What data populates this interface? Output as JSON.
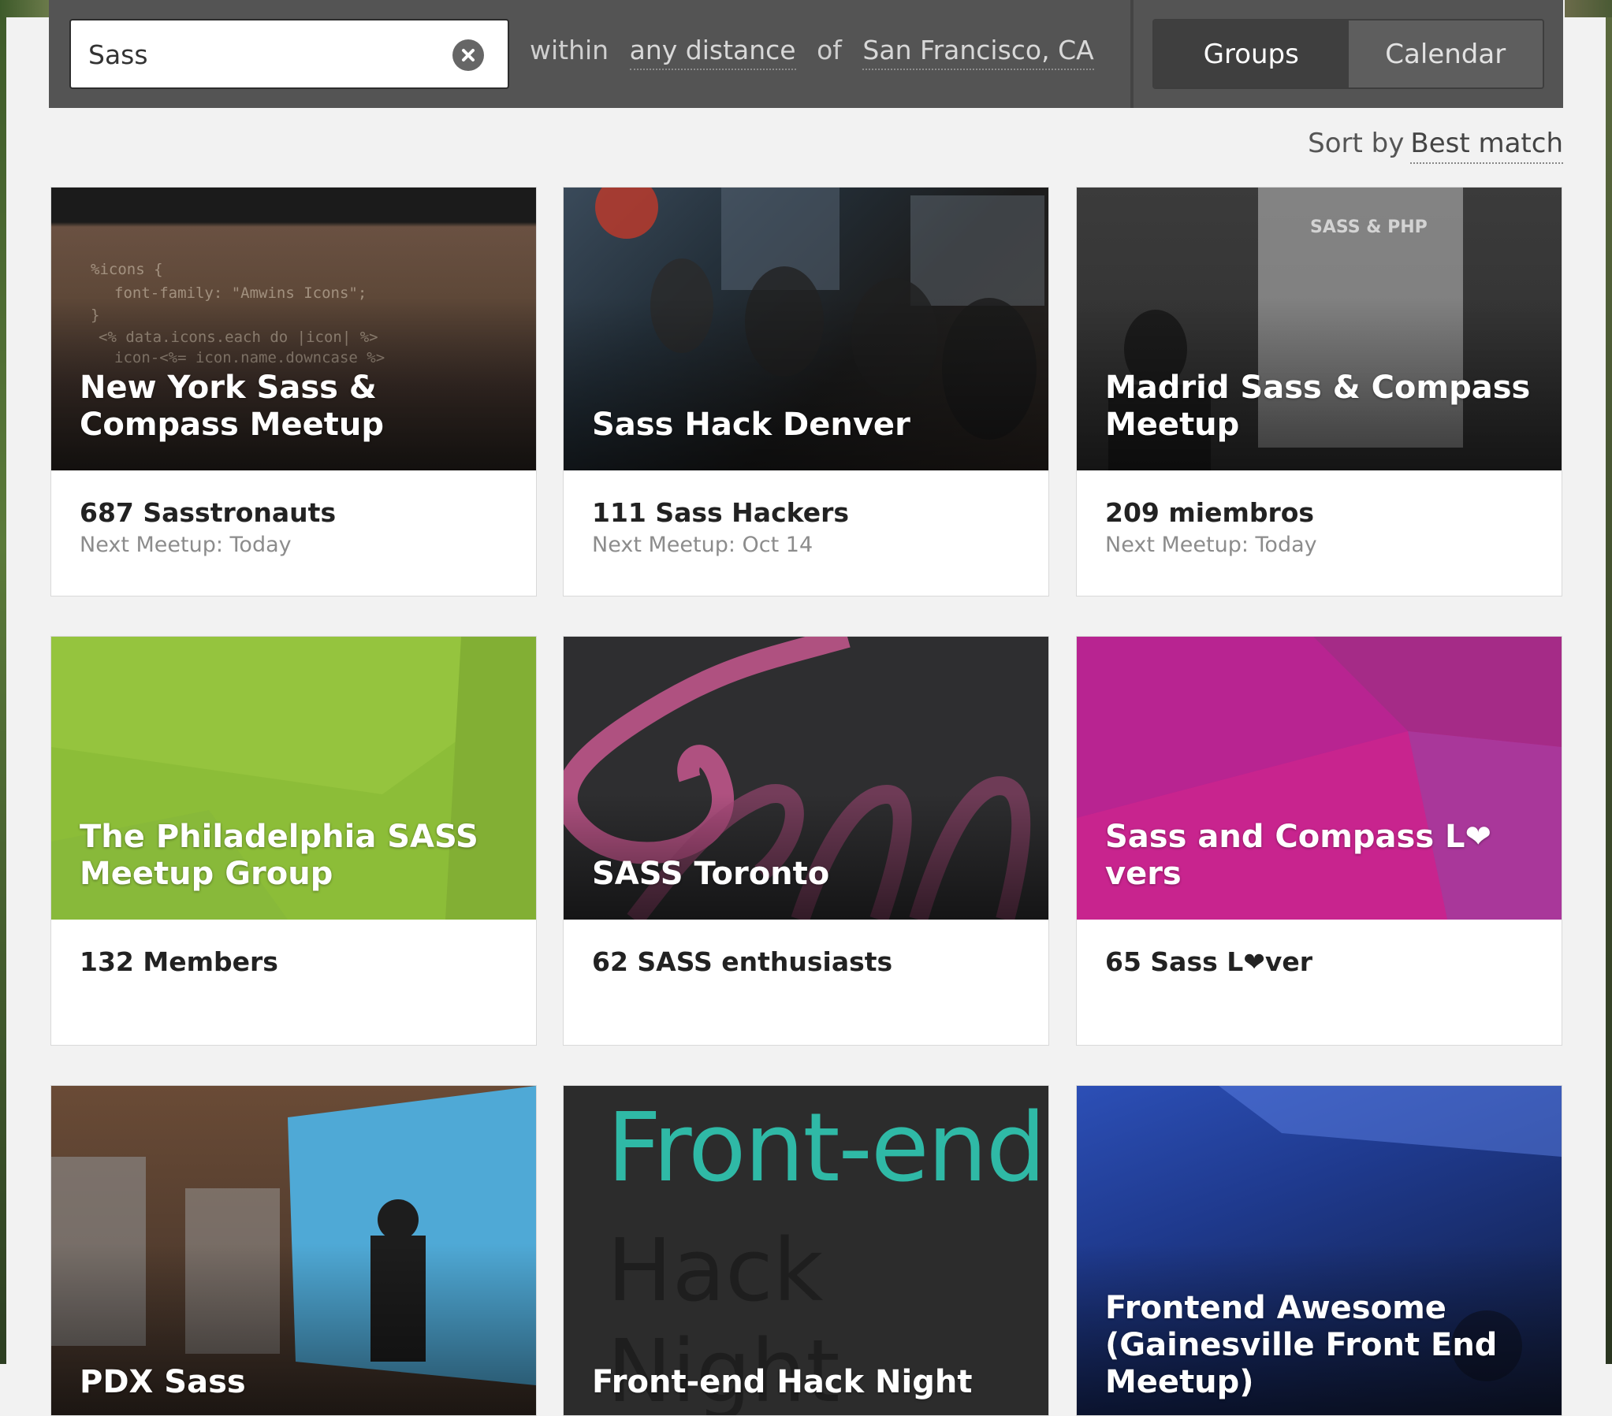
{
  "search": {
    "query": "Sass",
    "within_label": "within",
    "distance": "any distance",
    "of_label": "of",
    "location": "San Francisco, CA"
  },
  "view_toggle": {
    "groups": "Groups",
    "calendar": "Calendar",
    "active": "Groups"
  },
  "sort": {
    "label": "Sort by",
    "value": "Best match"
  },
  "groups": [
    {
      "title": "New York Sass & Compass Meetup",
      "count": "687 Sasstronauts",
      "next": "Next Meetup: Today"
    },
    {
      "title": "Sass Hack Denver",
      "count": "111 Sass Hackers",
      "next": "Next Meetup: Oct 14"
    },
    {
      "title": "Madrid Sass & Compass Meetup",
      "count": "209 miembros",
      "next": "Next Meetup: Today",
      "photo_text": "SASS & PHP"
    },
    {
      "title": "The Philadelphia SASS Meetup Group",
      "count": "132 Members",
      "next": ""
    },
    {
      "title": "SASS Toronto",
      "count": "62 SASS enthusiasts",
      "next": ""
    },
    {
      "title": "Sass and Compass L❤vers",
      "count": "65 Sass L❤ver",
      "next": ""
    },
    {
      "title": "PDX Sass",
      "count": "",
      "next": ""
    },
    {
      "title": "Front-end Hack Night",
      "count": "",
      "next": "",
      "photo_text_1": "Front-end",
      "photo_text_2": "Hack Night"
    },
    {
      "title": "Frontend Awesome (Gainesville Front End Meetup)",
      "count": "",
      "next": ""
    }
  ],
  "colors": {
    "green_card": "#8cbd38",
    "magenta_card": "#c2228f",
    "toronto_bg": "#2e2e30",
    "sass_pink": "#c6578e",
    "frontend_teal": "#2fb9a6"
  },
  "icons": {
    "clear": "clear-circle-x-icon",
    "heart": "heart-icon"
  }
}
